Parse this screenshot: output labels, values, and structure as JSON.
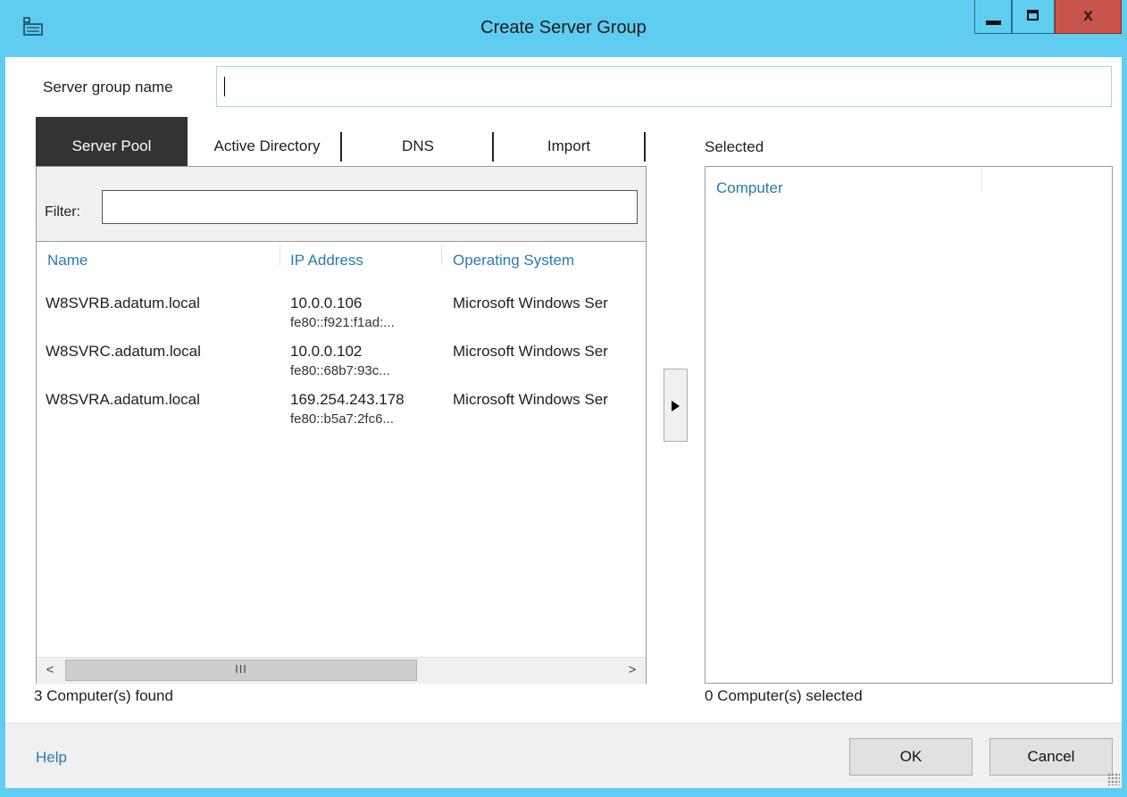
{
  "window": {
    "title": "Create Server Group",
    "app_icon": "server-manager-icon"
  },
  "form": {
    "group_name_label": "Server group name",
    "group_name_value": ""
  },
  "tabs": [
    {
      "label": "Server Pool",
      "active": true
    },
    {
      "label": "Active Directory",
      "active": false
    },
    {
      "label": "DNS",
      "active": false
    },
    {
      "label": "Import",
      "active": false
    }
  ],
  "filter": {
    "label": "Filter:",
    "value": ""
  },
  "pool_columns": [
    "Name",
    "IP Address",
    "Operating System"
  ],
  "pool_rows": [
    {
      "name": "W8SVRB.adatum.local",
      "ip": "10.0.0.106",
      "ipv6": "fe80::f921:f1ad:...",
      "os": "Microsoft Windows Ser"
    },
    {
      "name": "W8SVRC.adatum.local",
      "ip": "10.0.0.102",
      "ipv6": "fe80::68b7:93c...",
      "os": "Microsoft Windows Ser"
    },
    {
      "name": "W8SVRA.adatum.local",
      "ip": "169.254.243.178",
      "ipv6": "fe80::b5a7:2fc6...",
      "os": "Microsoft Windows Ser"
    }
  ],
  "scrollbar": {
    "left_arrow": "<",
    "right_arrow": ">",
    "grip": "III"
  },
  "found_text": "3 Computer(s) found",
  "selected": {
    "label": "Selected",
    "column": "Computer",
    "count_text": "0 Computer(s) selected"
  },
  "footer": {
    "help": "Help",
    "ok": "OK",
    "cancel": "Cancel"
  },
  "colors": {
    "titlebar": "#5ecdf0",
    "close_button": "#c9544a",
    "active_tab": "#333333",
    "link": "#2a7ab3"
  }
}
